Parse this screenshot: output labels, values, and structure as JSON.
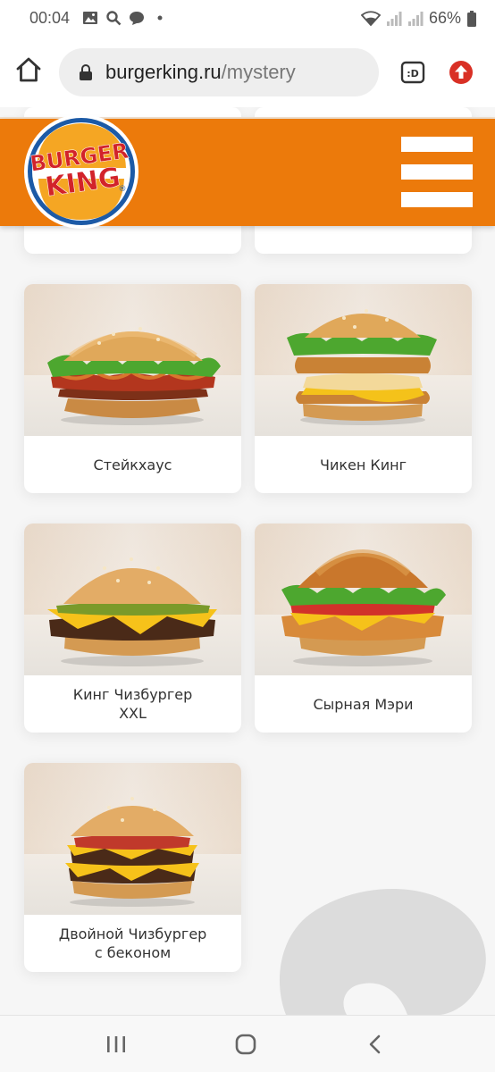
{
  "status_bar": {
    "time": "00:04",
    "battery": "66%",
    "icons": [
      "image-icon",
      "search-icon",
      "chat-icon",
      "dot-icon",
      "wifi-icon",
      "signal-icon",
      "signal-icon-2",
      "battery-icon"
    ]
  },
  "browser": {
    "url_host": "burgerking.ru",
    "url_path": "/mystery",
    "tab_badge": ":D"
  },
  "header": {
    "brand_line1": "BURGER",
    "brand_line2": "KING",
    "brand_mark": "®",
    "colors": {
      "header_bg": "#ec7a0b",
      "logo_red": "#d2232a",
      "logo_blue": "#1c5aa6",
      "logo_bun": "#f5a623"
    }
  },
  "menu_items": [
    {
      "name": "Стейкхаус",
      "image": "steakhouse-burger"
    },
    {
      "name": "Чикен Кинг",
      "image": "chicken-king-burger"
    },
    {
      "name": "Кинг Чизбургер\nXXL",
      "image": "king-cheeseburger-xxl"
    },
    {
      "name": "Сырная Мэри",
      "image": "cheesy-mary-burger"
    },
    {
      "name": "Двойной Чизбургер\nс беконом",
      "image": "double-bacon-cheeseburger"
    }
  ],
  "nav": {
    "icons": [
      "recent-apps-icon",
      "home-icon",
      "back-icon"
    ]
  }
}
